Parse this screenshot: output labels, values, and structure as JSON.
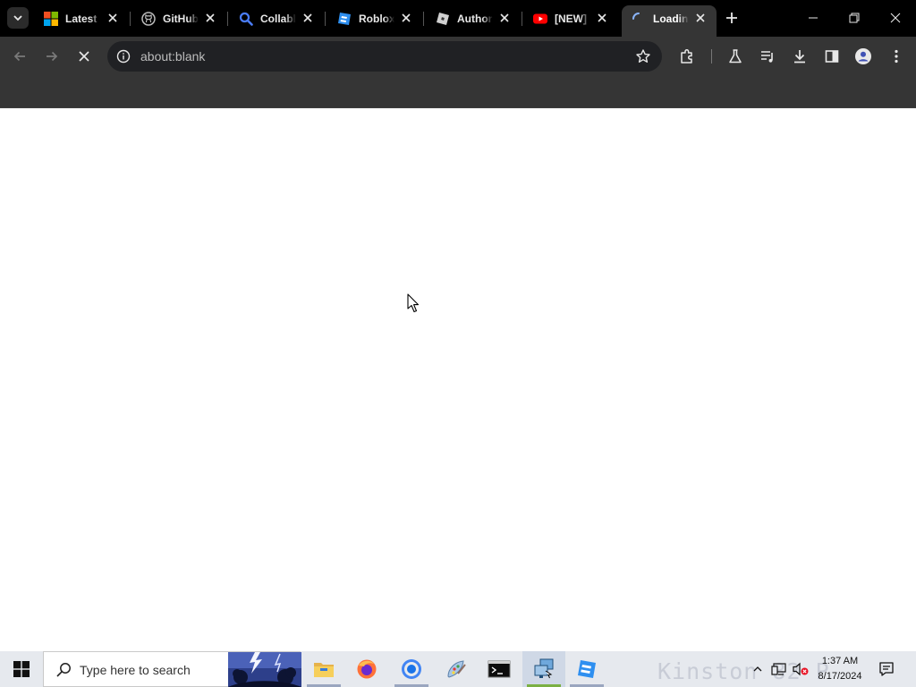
{
  "browser": {
    "tabs": [
      {
        "title": "Latest",
        "favicon": "microsoft-logo-icon",
        "active": false
      },
      {
        "title": "GitHub",
        "favicon": "github-icon",
        "active": false
      },
      {
        "title": "Collabl",
        "favicon": "magnifier-search-icon",
        "active": false
      },
      {
        "title": "Roblox",
        "favicon": "roblox-studio-icon",
        "active": false
      },
      {
        "title": "Author",
        "favicon": "roblox-icon",
        "active": false
      },
      {
        "title": "[NEW]",
        "favicon": "youtube-icon",
        "active": false
      },
      {
        "title": "Loadin",
        "favicon": "loading-spinner-icon",
        "active": true
      }
    ],
    "address": "about:blank",
    "page_state": "loading"
  },
  "taskbar": {
    "search_placeholder": "Type here to search",
    "apps": [
      "file-explorer-icon",
      "firefox-icon",
      "chrome-icon",
      "paint-icon",
      "terminal-icon",
      "remote-desktop-icon",
      "roblox-studio-icon"
    ],
    "watermark_text": "Kinston 82 P",
    "clock_time": "1:37 AM",
    "clock_date": "8/17/2024"
  },
  "colors": {
    "tabstrip": "#000000",
    "toolbar": "#353535",
    "omnibox": "#202124",
    "taskbar": "#e6e9ee"
  }
}
